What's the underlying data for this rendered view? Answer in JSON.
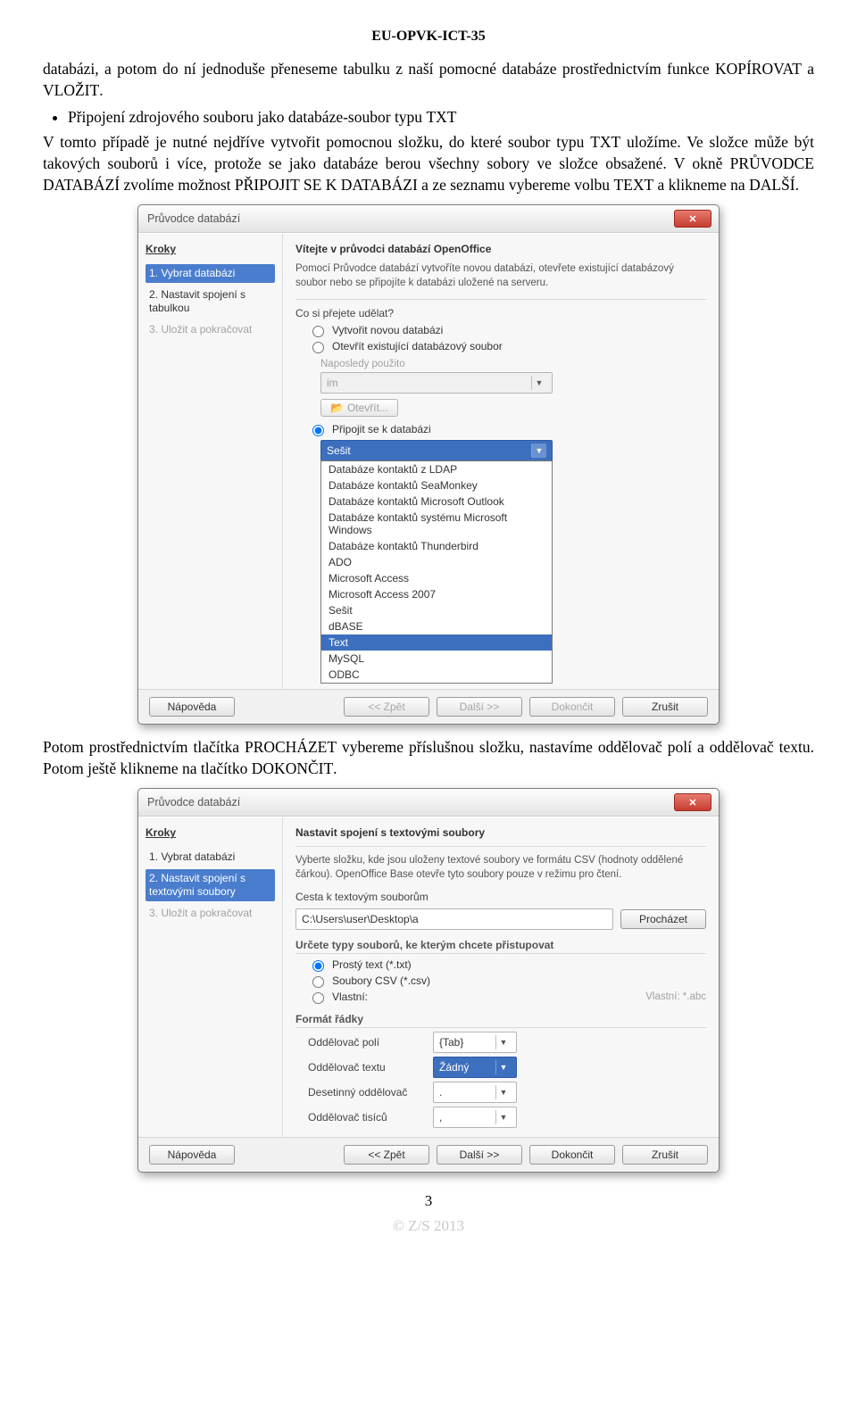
{
  "header": "EU-OPVK-ICT-35",
  "para1_a": "databázi, a potom do ní jednoduše přeneseme tabulku z naší pomocné databáze prostřednictvím funkce ",
  "para1_b": "KOPÍROVAT",
  "para1_c": " a ",
  "para1_d": "VLOŽIT",
  "para1_e": ".",
  "bullet1": "Připojení zdrojového souboru jako databáze-soubor typu ",
  "bullet1b": "TXT",
  "para2_a": "V tomto případě je nutné nejdříve vytvořit pomocnou složku, do které soubor typu ",
  "para2_b": "TXT",
  "para2_c": " uložíme. Ve složce může být takových souborů i více, protože se jako databáze berou všechny sobory ve složce obsažené. V okně ",
  "para2_d": "PRŮVODCE DATABÁZÍ",
  "para2_e": " zvolíme možnost ",
  "para2_f": "PŘIPOJIT SE K DATABÁZI",
  "para2_g": " a ze seznamu vybereme volbu ",
  "para2_h": "TEXT",
  "para2_i": " a klikneme na ",
  "para2_j": "DALŠÍ",
  "para2_k": ".",
  "dlg1": {
    "title": "Průvodce databází",
    "stepsH": "Kroky",
    "step1": "1. Vybrat databázi",
    "step2": "2. Nastavit spojení s tabulkou",
    "step3": "3. Uložit a pokračovat",
    "heading": "Vítejte v průvodci databází OpenOffice",
    "intro": "Pomocí Průvodce databází vytvoříte novou databázi, otevřete existující databázový soubor nebo se připojíte k databázi uložené na serveru.",
    "q": "Co si přejete udělat?",
    "r1": "Vytvořit novou databázi",
    "r2": "Otevřít existující databázový soubor",
    "recent": "Naposledy použito",
    "recentVal": "im",
    "openBtn": "Otevřít...",
    "r3": "Připojit se k databázi",
    "selCombo": "Sešit",
    "opts": [
      "Databáze kontaktů z LDAP",
      "Databáze kontaktů SeaMonkey",
      "Databáze kontaktů Microsoft Outlook",
      "Databáze kontaktů systému Microsoft Windows",
      "Databáze kontaktů Thunderbird",
      "ADO",
      "Microsoft Access",
      "Microsoft Access 2007",
      "Sešit",
      "dBASE",
      "Text",
      "MySQL",
      "ODBC"
    ],
    "optHilite": "Text",
    "help": "Nápověda",
    "back": "<< Zpět",
    "next": "Další >>",
    "finish": "Dokončit",
    "cancel": "Zrušit"
  },
  "para3_a": "Potom prostřednictvím tlačítka ",
  "para3_b": "PROCHÁZET",
  "para3_c": " vybereme příslušnou složku, nastavíme oddělovač polí a oddělovač textu. Potom ještě klikneme na tlačítko ",
  "para3_d": "DOKONČIT",
  "para3_e": ".",
  "dlg2": {
    "title": "Průvodce databází",
    "stepsH": "Kroky",
    "step1": "1. Vybrat databázi",
    "step2": "2. Nastavit spojení s textovými soubory",
    "step3": "3. Uložit a pokračovat",
    "heading": "Nastavit spojení s textovými soubory",
    "intro": "Vyberte složku, kde jsou uloženy textové soubory ve formátu CSV (hodnoty oddělené čárkou). OpenOffice Base otevře tyto soubory pouze v režimu pro čtení.",
    "pathLbl": "Cesta k textovým souborům",
    "pathVal": "C:\\Users\\user\\Desktop\\a",
    "browse": "Procházet",
    "typesLbl": "Určete typy souborů, ke kterým chcete přistupovat",
    "t1": "Prostý text (*.txt)",
    "t2": "Soubory CSV (*.csv)",
    "t3": "Vlastní:",
    "customPh": "Vlastní: *.abc",
    "formatLbl": "Formát řádky",
    "fSep": "Oddělovač polí",
    "fSepV": "{Tab}",
    "tSep": "Oddělovač textu",
    "tSepV": "Žádný",
    "dSep": "Desetinný oddělovač",
    "dSepV": ".",
    "thSep": "Oddělovač tisíců",
    "thSepV": ",",
    "help": "Nápověda",
    "back": "<< Zpět",
    "next": "Další >>",
    "finish": "Dokončit",
    "cancel": "Zrušit"
  },
  "pagenum": "3",
  "footer": "© Z/S 2013"
}
